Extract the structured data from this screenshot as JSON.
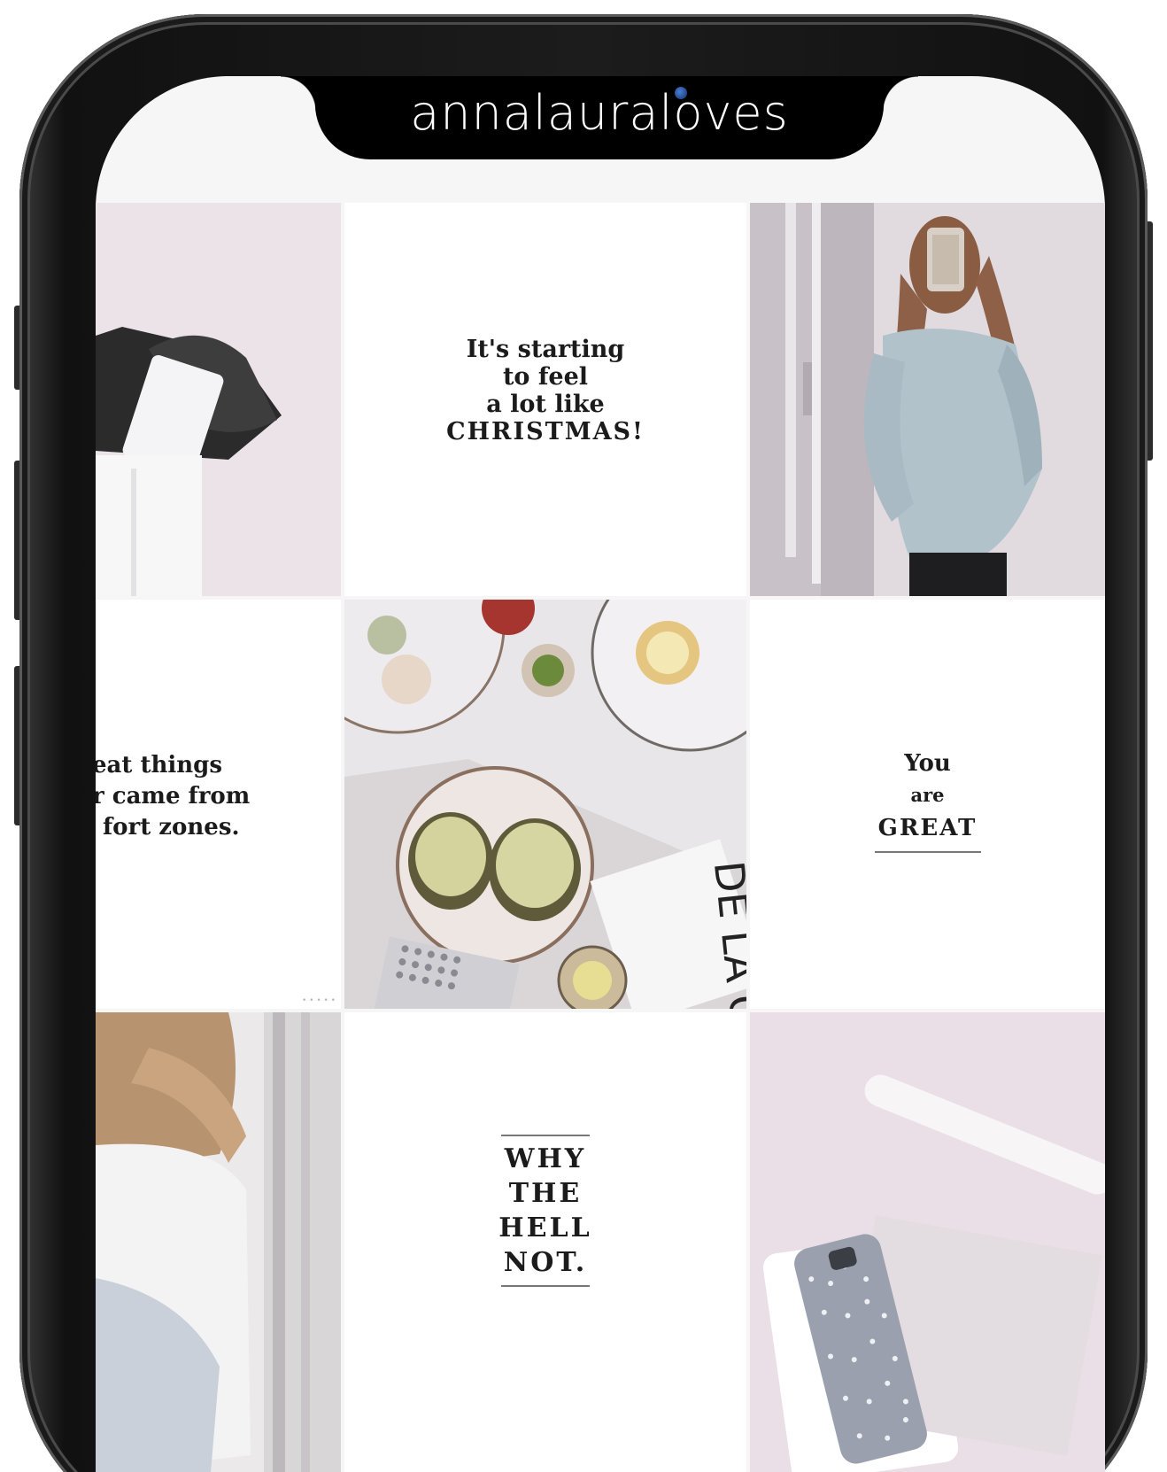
{
  "profile": {
    "handle": "annalauraloves"
  },
  "grid": {
    "quotes": {
      "christmas": [
        "It's starting",
        "to feel",
        "a lot like",
        "CHRISTMAS!"
      ],
      "comfort_zones": [
        "eat things",
        "r came from",
        "fort zones."
      ],
      "you_are_great": [
        "You",
        "are",
        "GREAT"
      ],
      "why_the_hell_not": [
        "WHY",
        "THE",
        "HELL",
        "NOT."
      ]
    },
    "photo_text": {
      "magazine": "DE LA C"
    }
  },
  "colors": {
    "phone_frame": "#1c1c1c",
    "screen_bg": "#f6f6f7",
    "pink_backdrop": "#ede2e8",
    "sweater": "#aebfc9",
    "text_dark": "#1b1b1b"
  }
}
